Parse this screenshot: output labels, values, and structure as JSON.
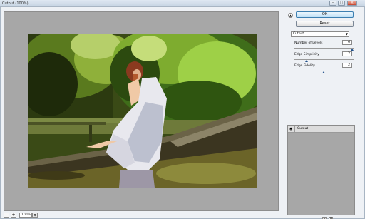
{
  "window": {
    "title": "Cutout (100%)",
    "minimize": "–",
    "maximize": "□",
    "close": "×"
  },
  "zoom": {
    "minus": "–",
    "plus": "+",
    "value": "100%",
    "dropdown_icon": "▼"
  },
  "panel": {
    "collapse_icon": "▲",
    "ok_label": "OK",
    "reset_label": "Reset",
    "filter_select": "Cutout",
    "filter_dropdown_icon": "▼",
    "params": [
      {
        "label": "Number of Levels",
        "value": "6",
        "level_fraction": 1.0
      },
      {
        "label": "Edge Simplicity",
        "value": "2",
        "level_fraction": 0.2
      },
      {
        "label": "Edge Fidelity",
        "value": "2",
        "level_fraction": 0.5
      }
    ]
  },
  "layers": {
    "items": [
      {
        "name": "Cutout",
        "visible_icon": "eye-icon"
      }
    ],
    "new_layer_icon": "new-effect-layer-icon",
    "delete_layer_icon": "trash-icon"
  },
  "colors": {
    "accent": "#3c7fb1",
    "preview_bg": "#a7a7a7"
  }
}
